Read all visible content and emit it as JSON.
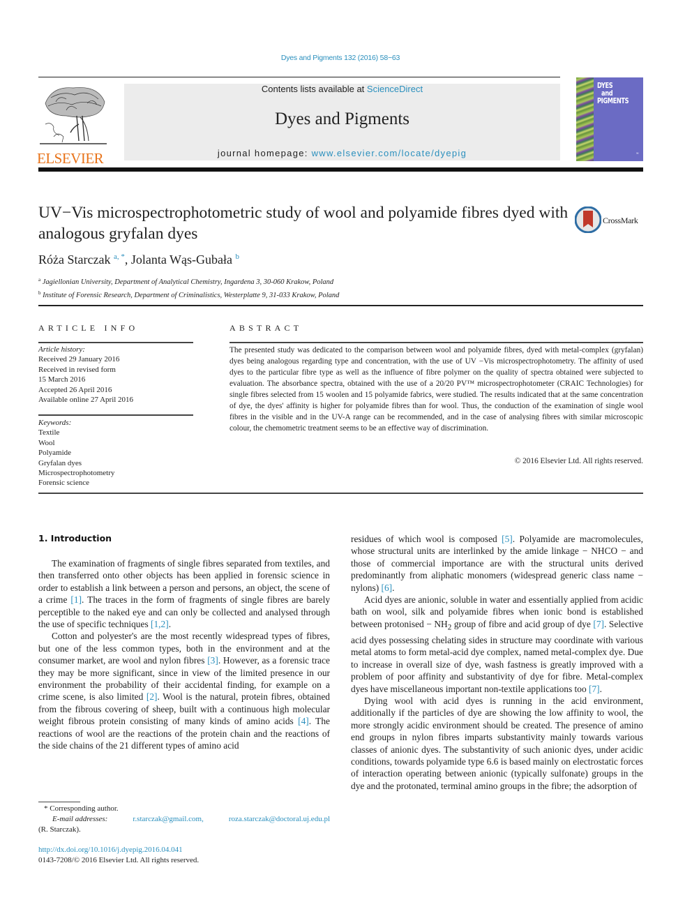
{
  "header": {
    "citation": "Dyes and Pigments 132 (2016) 58−63",
    "contents_prefix": "Contents lists available at ",
    "contents_link": "ScienceDirect",
    "journal_name": "Dyes and Pigments",
    "homepage_prefix": "journal homepage: ",
    "homepage_link": "www.elsevier.com/locate/dyepig",
    "publisher_logo_text": "ELSEVIER",
    "publisher_logo_color": "#e8731a",
    "cover": {
      "title_lines": [
        "DYES",
        "and",
        "PIGMENTS"
      ],
      "color": "#6b6bc4"
    },
    "crossmark_label": "CrossMark"
  },
  "article": {
    "title": "UV−Vis microspectrophotometric study of wool and polyamide fibres dyed with analogous gryfalan dyes",
    "authors": [
      {
        "name": "Róża Starczak",
        "affil": "a, *"
      },
      {
        "name": "Jolanta Wąs-Gubała",
        "affil": "b"
      }
    ],
    "affiliations": [
      {
        "mark": "a",
        "text": "Jagiellonian University, Department of Analytical Chemistry, Ingardena 3, 30-060 Krakow, Poland"
      },
      {
        "mark": "b",
        "text": "Institute of Forensic Research, Department of Criminalistics, Westerplatte 9, 31-033 Krakow, Poland"
      }
    ]
  },
  "article_info": {
    "label": "ARTICLE INFO",
    "history_label": "Article history:",
    "history": [
      "Received 29 January 2016",
      "Received in revised form",
      "15 March 2016",
      "Accepted 26 April 2016",
      "Available online 27 April 2016"
    ],
    "keywords_label": "Keywords:",
    "keywords": [
      "Textile",
      "Wool",
      "Polyamide",
      "Gryfalan dyes",
      "Microspectrophotometry",
      "Forensic science"
    ]
  },
  "abstract": {
    "label": "ABSTRACT",
    "text": "The presented study was dedicated to the comparison between wool and polyamide fibres, dyed with metal-complex (gryfalan) dyes being analogous regarding type and concentration, with the use of UV −Vis microspectrophotometry. The affinity of used dyes to the particular fibre type as well as the in­fluence of fibre polymer on the quality of spectra obtained were subjected to evaluation. The absorbance spectra, obtained with the use of a 20/20 PV™ microspectrophotometer (CRAIC Technologies) for single fibres selected from 15 woolen and 15 polyamide fabrics, were studied. The results indicated that at the same concentration of dye, the dyes' affinity is higher for polyamide fibres than for wool. Thus, the conduction of the examination of single wool fibres in the visible and in the UV-A range can be rec­ommended, and in the case of analysing fibres with similar microscopic colour, the chemometric treatment seems to be an effective way of discrimination.",
    "copyright": "© 2016 Elsevier Ltd. All rights reserved."
  },
  "body": {
    "section_heading": "1.  Introduction",
    "col1": {
      "p1": {
        "a": "The examination of fragments of single fibres separated from textiles, and then transferred onto other objects has been applied in forensic science in order to establish a link between a person and persons, an object, the scene of a crime ",
        "ref1": "[1]",
        "b": ". The traces in the form of fragments of single fibres are barely perceptible to the naked eye and can only be collected and analysed through the use of specific techniques ",
        "ref2": "[1,2]",
        "c": "."
      },
      "p2": {
        "a": "Cotton and polyester's are the most recently widespread types of fibres, but one of the less common types, both in the environ­ment and at the consumer market, are wool and nylon fibres ",
        "ref1": "[3]",
        "b": ". However, as a forensic trace they may be more significant, since in view of the limited presence in our environment the probability of their accidental finding, for example on a crime scene, is also limited ",
        "ref2": "[2]",
        "c": ". Wool is the natural, protein fibres, obtained from the fibrous covering of sheep, built with a continuous high molecular weight fibrous protein consisting of many kinds of amino acids ",
        "ref3": "[4]",
        "d": ". The reactions of wool are the reactions of the protein chain and the reactions of the side chains of the 21 different types of amino acid"
      }
    },
    "col2": {
      "p1": {
        "a": "residues of which wool is composed ",
        "ref1": "[5]",
        "b": ". Polyamide are macro­molecules, whose structural units are interlinked by the amide linkage − NHCO − and those of commercial importance are with the structural units derived predominantly from aliphatic mono­mers (widespread generic class name − nylons) ",
        "ref2": "[6]",
        "c": "."
      },
      "p2": {
        "a": "Acid dyes are anionic, soluble in water and essentially applied from acidic bath on wool, silk and polyamide fibres when ionic bond is established between protonised − NH",
        "sub": "2",
        "b": " group of fibre and acid group of dye ",
        "ref1": "[7]",
        "c": ". Selective acid dyes possessing chelating sides in structure may coordinate with various metal atoms to form metal-acid dye complex, named metal-complex dye. Due to in­crease in overall size of dye, wash fastness is greatly improved with a problem of poor affinity and substantivity of dye for fibre. Metal-complex dyes have miscellaneous important non-textile applica­tions too ",
        "ref2": "[7]",
        "d": "."
      },
      "p3": "Dying wool with acid dyes is running in the acid environment, additionally if the particles of dye are showing the low affinity to wool, the more strongly acidic environment should be created. The presence of amino end groups in nylon fibres imparts substantivity mainly towards various classes of anionic dyes. The substantivity of such anionic dyes, under acidic conditions, towards polyamide type 6.6 is based mainly on electrostatic forces of interaction operating between anionic (typically sulfonate) groups in the dye and the protonated, terminal amino groups in the fibre; the adsorption of"
    }
  },
  "footnote": {
    "marker": "*",
    "corresponding": "Corresponding author.",
    "email_label": "E-mail addresses:",
    "emails": [
      "r.starczak@gmail.com,",
      "roza.starczak@doctoral.uj.edu.pl"
    ],
    "owner": "(R. Starczak).",
    "doi": "http://dx.doi.org/10.1016/j.dyepig.2016.04.041",
    "issn_copyright": "0143-7208/© 2016 Elsevier Ltd. All rights reserved."
  },
  "colors": {
    "link": "#2a8fbd",
    "masthead_bg": "#ececec",
    "text": "#222222"
  }
}
